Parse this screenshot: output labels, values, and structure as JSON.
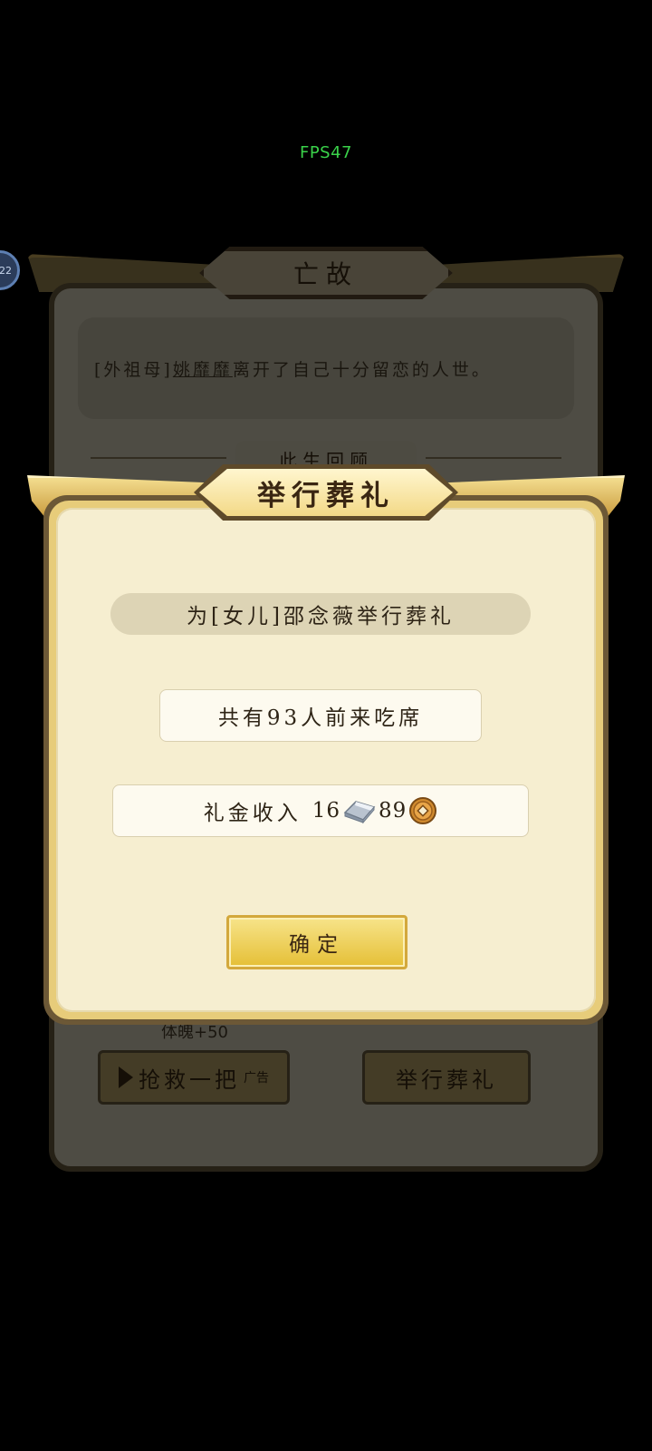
{
  "fps": "FPS47",
  "avatar_badge": "22",
  "background_dialog": {
    "title": "亡故",
    "message_prefix": "[外祖母]",
    "message_name": "姚靡靡",
    "message_rest": "离开了自己十分留恋的人世。",
    "section_label": "此生回顾",
    "stat": "体魄+50",
    "rescue_button": "抢救一把",
    "rescue_ad_tag": "广告",
    "hold_funeral_button": "举行葬礼"
  },
  "dialog": {
    "title": "举行葬礼",
    "subject": "为[女儿]邵念薇举行葬礼",
    "guests": "共有93人前来吃席",
    "gift_label": "礼金收入",
    "silver_amount": "16",
    "copper_amount": "89",
    "silver_icon": "silver-ingot-icon",
    "copper_icon": "copper-coin-icon",
    "confirm_button": "确定"
  },
  "colors": {
    "fps_text": "#3ad24a",
    "panel_cream": "#f6eed0",
    "gold_accent": "#e7cc7a",
    "button_gold": "#e5bf36"
  }
}
